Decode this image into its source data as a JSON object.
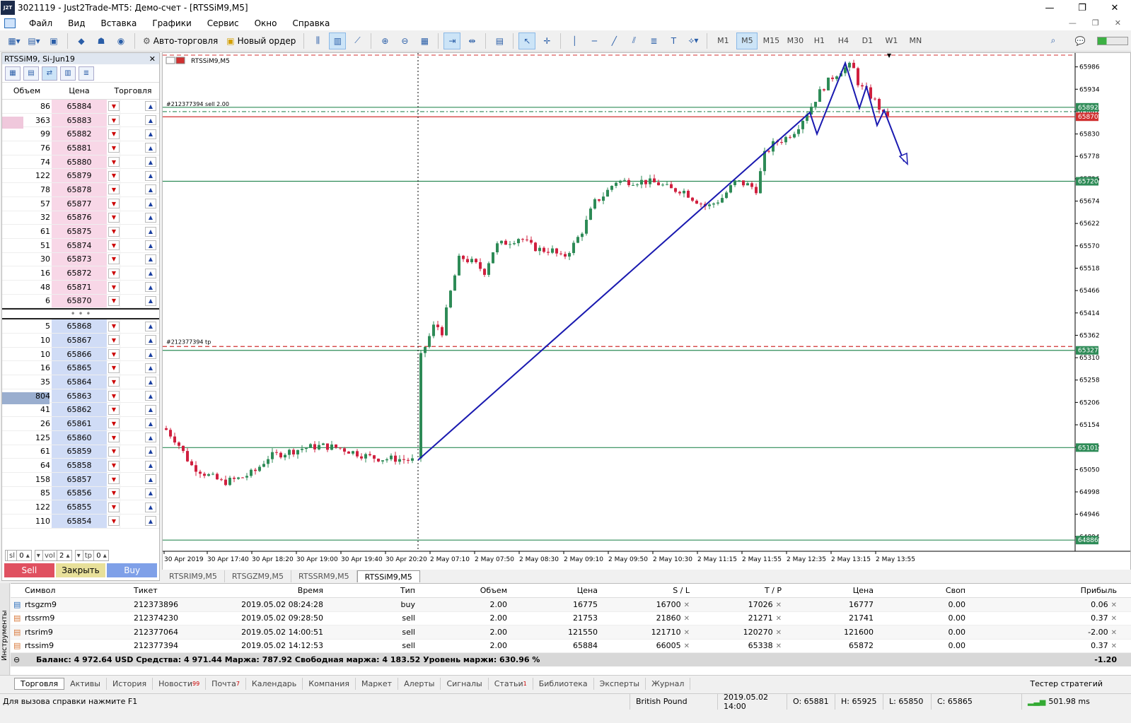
{
  "window": {
    "title": "3021119 - Just2Trade-MT5: Демо-счет - [RTSSiM9,M5]",
    "logo": "J2T"
  },
  "menu": [
    "Файл",
    "Вид",
    "Вставка",
    "Графики",
    "Сервис",
    "Окно",
    "Справка"
  ],
  "toolbar": {
    "autotrade": "Авто-торговля",
    "neworder": "Новый ордер",
    "timeframes": [
      "M1",
      "M5",
      "M15",
      "M30",
      "H1",
      "H4",
      "D1",
      "W1",
      "MN"
    ],
    "active_tf": "M5"
  },
  "dom": {
    "title": "RTSSiM9, Si-Jun19",
    "col_volume": "Объем",
    "col_price": "Цена",
    "col_trade": "Торговля",
    "asks": [
      [
        "86",
        "65884"
      ],
      [
        "363",
        "65883"
      ],
      [
        "99",
        "65882"
      ],
      [
        "76",
        "65881"
      ],
      [
        "74",
        "65880"
      ],
      [
        "122",
        "65879"
      ],
      [
        "78",
        "65878"
      ],
      [
        "57",
        "65877"
      ],
      [
        "32",
        "65876"
      ],
      [
        "61",
        "65875"
      ],
      [
        "51",
        "65874"
      ],
      [
        "30",
        "65873"
      ],
      [
        "16",
        "65872"
      ],
      [
        "48",
        "65871"
      ],
      [
        "6",
        "65870"
      ]
    ],
    "bids": [
      [
        "5",
        "65868"
      ],
      [
        "10",
        "65867"
      ],
      [
        "10",
        "65866"
      ],
      [
        "16",
        "65865"
      ],
      [
        "35",
        "65864"
      ],
      [
        "804",
        "65863"
      ],
      [
        "41",
        "65862"
      ],
      [
        "26",
        "65861"
      ],
      [
        "125",
        "65860"
      ],
      [
        "61",
        "65859"
      ],
      [
        "64",
        "65858"
      ],
      [
        "158",
        "65857"
      ],
      [
        "85",
        "65856"
      ],
      [
        "122",
        "65855"
      ],
      [
        "110",
        "65854"
      ]
    ],
    "dots": "• • •",
    "sl_label": "sl",
    "sl_value": "0",
    "vol_label": "vol",
    "vol_value": "2",
    "tp_label": "tp",
    "tp_value": "0",
    "sell": "Sell",
    "close": "Закрыть",
    "buy": "Buy"
  },
  "chart": {
    "label": "RTSSiM9,M5",
    "order_label": "#212377394 sell 2.00",
    "tp_label": "#212377394 tp",
    "y_ticks": [
      "65986",
      "65934",
      "65882",
      "65830",
      "65778",
      "65726",
      "65674",
      "65622",
      "65570",
      "65518",
      "65466",
      "65414",
      "65362",
      "65310",
      "65258",
      "65206",
      "65154",
      "65102",
      "65050",
      "64998",
      "64946",
      "64894"
    ],
    "price_tags": [
      {
        "value": "65892",
        "color": "#2e8b57"
      },
      {
        "value": "65870",
        "color": "#d03030"
      },
      {
        "value": "65720",
        "color": "#2e8b57"
      },
      {
        "value": "65327",
        "color": "#2e8b57"
      },
      {
        "value": "65101",
        "color": "#2e8b57"
      },
      {
        "value": "64886",
        "color": "#2e8b57"
      }
    ],
    "x_ticks": [
      "30 Apr 2019",
      "30 Apr 17:40",
      "30 Apr 18:20",
      "30 Apr 19:00",
      "30 Apr 19:40",
      "30 Apr 20:20",
      "2 May 07:10",
      "2 May 07:50",
      "2 May 08:30",
      "2 May 09:10",
      "2 May 09:50",
      "2 May 10:30",
      "2 May 11:15",
      "2 May 11:55",
      "2 May 12:35",
      "2 May 13:15",
      "2 May 13:55"
    ],
    "colors": {
      "bull": "#2e8b57",
      "bear": "#d0203f",
      "trend": "#1a1ab0"
    }
  },
  "chart_tabs": [
    "RTSRIM9,M5",
    "RTSGZM9,M5",
    "RTSSRM9,M5",
    "RTSSiM9,M5"
  ],
  "active_chart_tab": "RTSSiM9,M5",
  "terminal": {
    "headers": [
      "Символ",
      "Тикет",
      "Время",
      "Тип",
      "Объем",
      "Цена",
      "S / L",
      "T / P",
      "Цена",
      "Своп",
      "Прибыль"
    ],
    "rows": [
      [
        "rtsgzm9",
        "212373896",
        "2019.05.02 08:24:28",
        "buy",
        "2.00",
        "16775",
        "16700",
        "17026",
        "16777",
        "0.00",
        "0.06"
      ],
      [
        "rtssrm9",
        "212374230",
        "2019.05.02 09:28:50",
        "sell",
        "2.00",
        "21753",
        "21860",
        "21271",
        "21741",
        "0.00",
        "0.37"
      ],
      [
        "rtsrim9",
        "212377064",
        "2019.05.02 14:00:51",
        "sell",
        "2.00",
        "121550",
        "121710",
        "120270",
        "121600",
        "0.00",
        "-2.00"
      ],
      [
        "rtssim9",
        "212377394",
        "2019.05.02 14:12:53",
        "sell",
        "2.00",
        "65884",
        "66005",
        "65338",
        "65872",
        "0.00",
        "0.37"
      ]
    ],
    "balance": "Баланс: 4 972.64 USD  Средства: 4 971.44  Маржа: 787.92  Свободная маржа: 4 183.52  Уровень маржи: 630.96 %",
    "total": "-1.20"
  },
  "bottom_tabs": [
    "Торговля",
    "Активы",
    "История",
    "Новости",
    "Почта",
    "Календарь",
    "Компания",
    "Маркет",
    "Алерты",
    "Сигналы",
    "Статьи",
    "Библиотека",
    "Эксперты",
    "Журнал"
  ],
  "news_count": "99",
  "mail_count": "7",
  "articles_count": "1",
  "strategy_tester": "Тестер стратегий",
  "sidebar_label": "Инструменты",
  "status": {
    "help": "Для вызова справки нажмите F1",
    "profile": "British Pound",
    "datetime": "2019.05.02 14:00",
    "o": "O: 65881",
    "h": "H: 65925",
    "l": "L: 65850",
    "c": "C: 65865",
    "ping": "501.98 ms"
  }
}
